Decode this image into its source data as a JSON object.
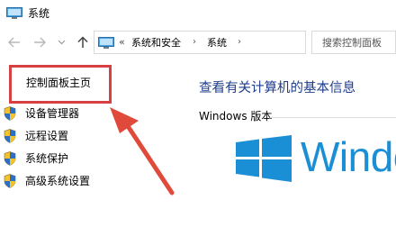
{
  "window": {
    "title": "系统",
    "icon": "computer-monitor-icon"
  },
  "navigation": {
    "back_icon": "arrow-left-icon",
    "forward_icon": "arrow-right-icon",
    "recent_icon": "chevron-down-icon",
    "up_icon": "arrow-up-icon"
  },
  "address_bar": {
    "overflow_marker": "«",
    "crumbs": [
      "系统和安全",
      "系统"
    ],
    "dropdown_icon": "chevron-down-icon",
    "refresh_icon": "refresh-icon"
  },
  "search": {
    "placeholder": "搜索控制面板"
  },
  "sidebar": {
    "home_link": "控制面板主页",
    "highlight_color": "#d64040",
    "items": [
      {
        "label": "设备管理器",
        "icon": "uac-shield-icon"
      },
      {
        "label": "远程设置",
        "icon": "uac-shield-icon"
      },
      {
        "label": "系统保护",
        "icon": "uac-shield-icon"
      },
      {
        "label": "高级系统设置",
        "icon": "uac-shield-icon"
      }
    ]
  },
  "main": {
    "heading": "查看有关计算机的基本信息",
    "heading_color": "#1e3c8c",
    "section_label": "Windows 版本",
    "brand_text": "Windo",
    "brand_color": "#1a8fd6"
  },
  "annotation": {
    "arrow_color": "#e04a3a"
  }
}
